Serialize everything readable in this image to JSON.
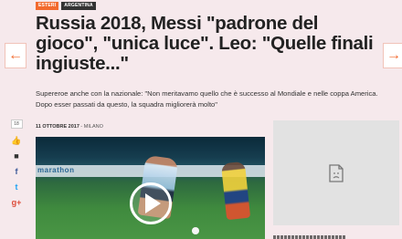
{
  "nav": {
    "prev_arrow": "←",
    "next_arrow": "→"
  },
  "tags": {
    "section": "ESTERI",
    "topic": "ARGENTINA"
  },
  "article": {
    "headline": "Russia 2018, Messi \"padrone del gioco\", \"unica luce\". Leo: \"Quelle finali ingiuste...\"",
    "subtitle": "Supereroe anche con la nazionale: \"Non meritavamo quello che è successo al Mondiale e nelle coppa America. Dopo esser passati da questo, la squadra migliorerà molto\"",
    "date": "11 OTTOBRE 2017",
    "location": " - MILANO"
  },
  "social": {
    "count": "18",
    "icons": [
      "thumbs-up-icon",
      "comment-icon",
      "facebook-icon",
      "twitter-icon",
      "google-plus-icon"
    ],
    "fb_glyph": "f",
    "tw_glyph": "t",
    "gp_glyph": "g+",
    "like_glyph": "👍",
    "comment_glyph": "■"
  },
  "video": {
    "board_text": "marathon"
  },
  "colors": {
    "accent": "#f26a2e",
    "background": "#f6e9ec",
    "facebook": "#3b5998",
    "twitter": "#1da1f2",
    "google_plus": "#dd4b39"
  }
}
